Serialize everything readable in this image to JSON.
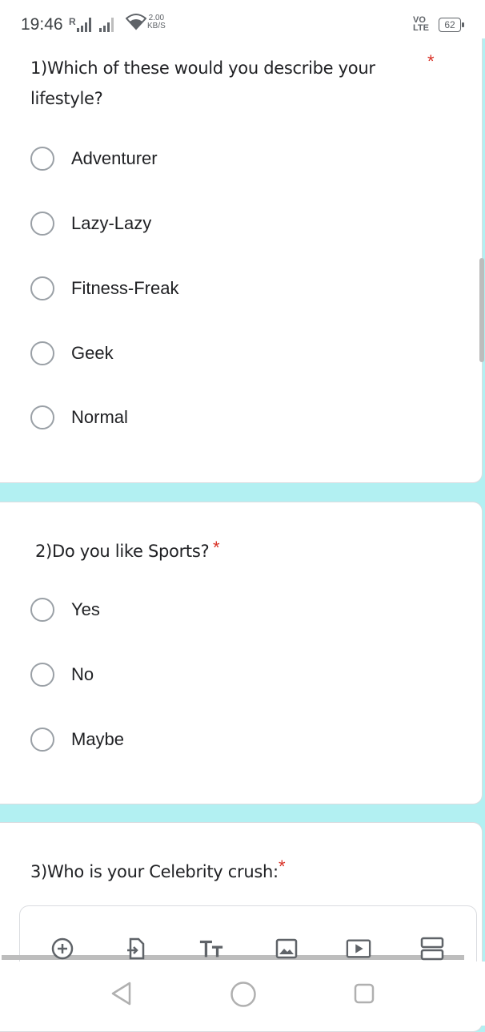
{
  "status_bar": {
    "time": "19:46",
    "signal_label": "R",
    "net_speed_value": "2.00",
    "net_speed_unit": "KB/S",
    "volte_top": "VoLTE",
    "volte_line1": "VO",
    "volte_line2": "LTE",
    "battery_level": "62"
  },
  "form": {
    "questions": [
      {
        "text": "1)Which of these would you describe your lifestyle?",
        "required_mark": "*",
        "options": [
          "Adventurer",
          "Lazy-Lazy",
          "Fitness-Freak",
          "Geek",
          "Normal"
        ]
      },
      {
        "text": "2)Do you like Sports?",
        "required_mark": "*",
        "options": [
          "Yes",
          "No",
          "Maybe"
        ]
      },
      {
        "text": "3)Who is your Celebrity crush:",
        "required_mark": "*"
      }
    ]
  },
  "toolbar": {
    "icons": [
      "add-circle-icon",
      "import-questions-icon",
      "title-text-icon",
      "image-icon",
      "video-icon",
      "section-icon"
    ]
  },
  "nav_bar": {
    "icons": [
      "back-icon",
      "home-icon",
      "recents-icon"
    ]
  },
  "colors": {
    "background": "#b2f0f2",
    "required": "#d93025",
    "radio_border": "#9aa0a6"
  }
}
